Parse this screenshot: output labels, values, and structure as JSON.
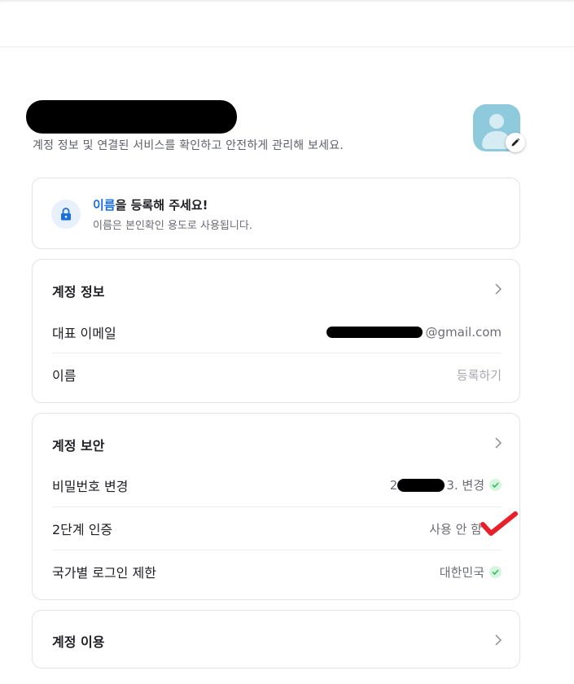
{
  "header": {
    "subtitle": "계정 정보 및 연결된 서비스를 확인하고 안전하게 관리해 보세요."
  },
  "notice": {
    "title_highlight": "이름",
    "title_rest": "을 등록해 주세요!",
    "subtitle": "이름은 본인확인 용도로 사용됩니다."
  },
  "account_info": {
    "title": "계정 정보",
    "rows": [
      {
        "label": "대표 이메일",
        "value": "@gmail.com"
      },
      {
        "label": "이름",
        "value": "등록하기"
      }
    ]
  },
  "account_security": {
    "title": "계정 보안",
    "rows": [
      {
        "label": "비밀번호 변경",
        "value_prefix": "2",
        "value": "3. 변경"
      },
      {
        "label": "2단계 인증",
        "value": "사용 안 함"
      },
      {
        "label": "국가별 로그인 제한",
        "value": "대한민국"
      }
    ]
  },
  "account_usage": {
    "title": "계정 이용"
  },
  "colors": {
    "accent": "#1a6fde",
    "check_green": "#2fbf5a",
    "annotation_red": "#e8202a",
    "avatar_bg": "#8fc9dc"
  },
  "icons": [
    "edit-pencil-icon",
    "lock-icon",
    "chevron-right-icon",
    "check-circle-icon",
    "default-avatar-icon"
  ]
}
